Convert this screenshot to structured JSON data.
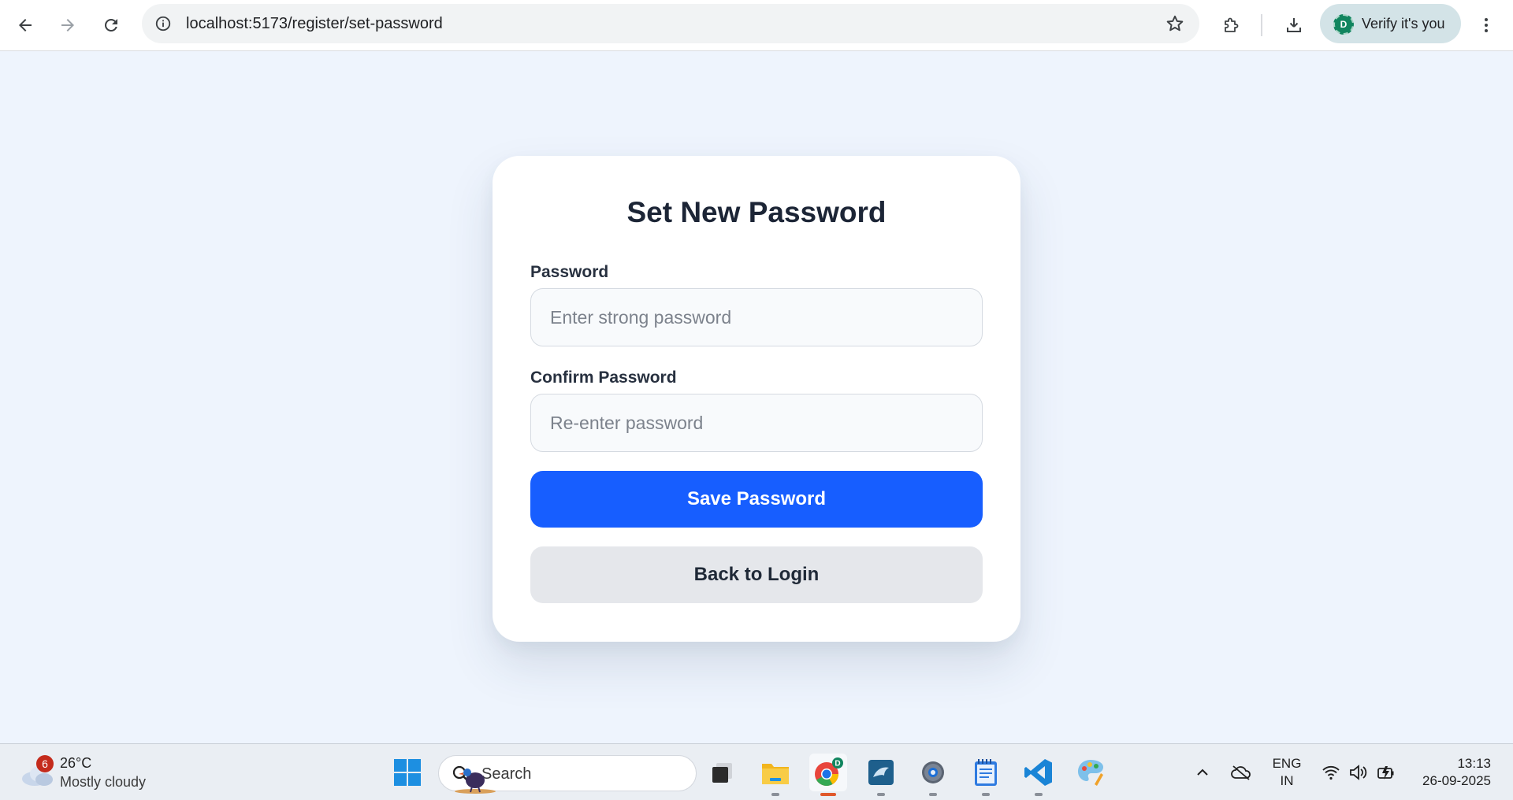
{
  "browser": {
    "url": "localhost:5173/register/set-password",
    "verify_chip_label": "Verify it's you",
    "profile_initial": "D"
  },
  "form": {
    "title": "Set New Password",
    "password_label": "Password",
    "password_placeholder": "Enter strong password",
    "confirm_label": "Confirm Password",
    "confirm_placeholder": "Re-enter password",
    "save_button": "Save Password",
    "back_button": "Back to Login"
  },
  "taskbar": {
    "weather_badge": "6",
    "weather_temp": "26°C",
    "weather_condition": "Mostly cloudy",
    "search_label": "Search",
    "chrome_profile_initial": "D",
    "lang_line1": "ENG",
    "lang_line2": "IN",
    "time": "13:13",
    "date": "26-09-2025"
  },
  "colors": {
    "page_background": "#eef4fd",
    "primary_button": "#175eff",
    "secondary_button": "#e5e7eb",
    "title_text": "#1c2536"
  }
}
